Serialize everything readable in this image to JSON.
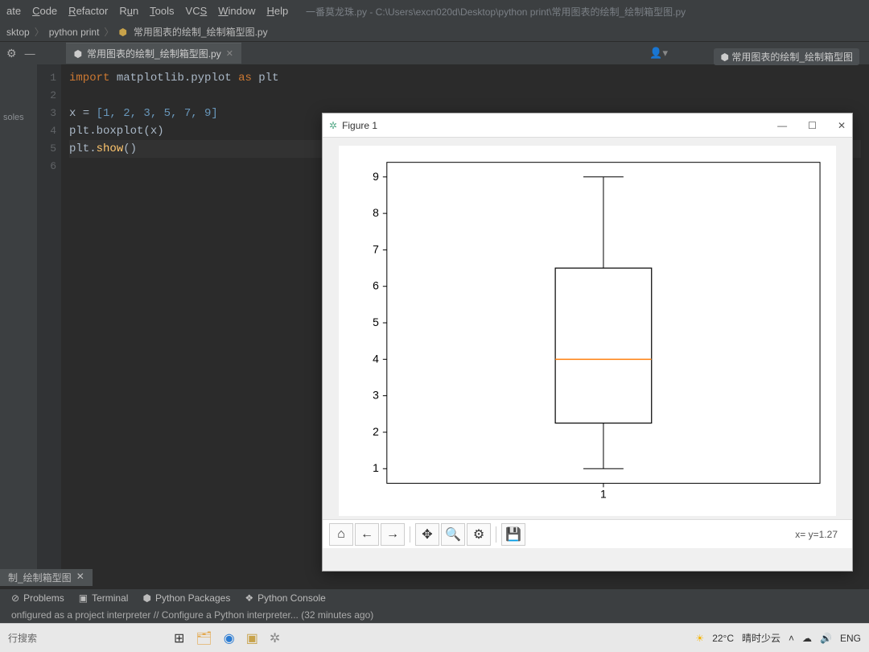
{
  "menu": {
    "items": [
      "ate",
      "Code",
      "Refactor",
      "Run",
      "Tools",
      "VCS",
      "Window",
      "Help"
    ],
    "title_path": "一番莫龙珠.py - C:\\Users\\excn020d\\Desktop\\python  print\\常用图表的绘制_绘制箱型图.py"
  },
  "breadcrumb": {
    "parts": [
      "sktop",
      "python  print",
      "常用图表的绘制_绘制箱型图.py"
    ],
    "topright": "常用图表的绘制_绘制箱型图"
  },
  "sidepanel": {
    "label": "soles"
  },
  "editor": {
    "tab": "常用图表的绘制_绘制箱型图.py",
    "lines": [
      "1",
      "2",
      "3",
      "4",
      "5",
      "6"
    ],
    "code": {
      "l1_import": "import",
      "l1_mod": "matplotlib.pyplot",
      "l1_as": "as",
      "l1_alias": "plt",
      "l3_var": "x = ",
      "l3_list": "[1, 2, 3, 5, 7, 9]",
      "l4": "plt.boxplot(x)",
      "l5a": "plt.",
      "l5b": "show",
      "l5c": "()"
    }
  },
  "mpl": {
    "title": "Figure 1",
    "coords": "x= y=1.27",
    "toolbar": {
      "home": "⌂",
      "back": "←",
      "fwd": "→",
      "pan": "✥",
      "zoom": "🔍",
      "cfg": "⚙",
      "save": "💾"
    }
  },
  "chart_data": {
    "type": "boxplot",
    "title": "",
    "xlabel": "",
    "ylabel": "",
    "xlim": [
      0.5,
      1.5
    ],
    "ylim": [
      0.6,
      9.4
    ],
    "xticks": [
      1
    ],
    "yticks": [
      1,
      2,
      3,
      4,
      5,
      6,
      7,
      8,
      9
    ],
    "series": [
      {
        "name": "1",
        "raw_data": [
          1,
          2,
          3,
          5,
          7,
          9
        ],
        "min": 1,
        "q1": 2.25,
        "median": 4.0,
        "q3": 6.5,
        "max": 9
      }
    ]
  },
  "bottom": {
    "file_tab": "制_绘制箱型图",
    "tabs": {
      "problems": "Problems",
      "terminal": "Terminal",
      "packages": "Python Packages",
      "console": "Python Console"
    },
    "status": "onfigured as a project interpreter // Configure a Python interpreter... (32 minutes ago)"
  },
  "taskbar": {
    "search": "行搜索",
    "weather_temp": "22°C",
    "weather_text": "晴时少云",
    "lang": "ENG"
  }
}
